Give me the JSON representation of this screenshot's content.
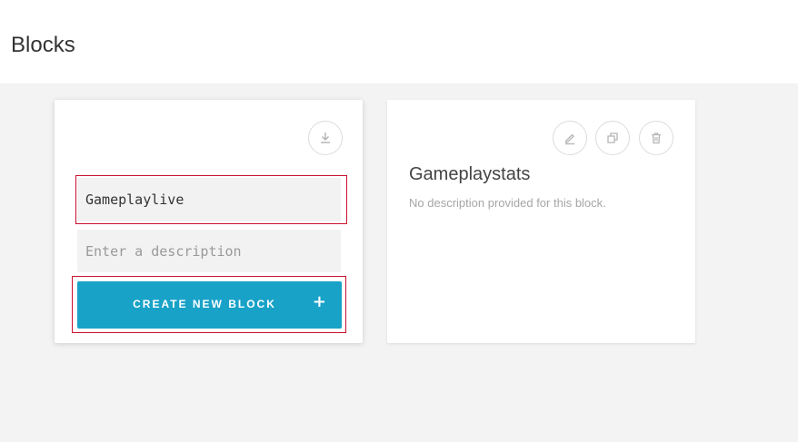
{
  "page": {
    "title": "Blocks"
  },
  "new_block": {
    "name_value": "Gameplaylive",
    "description_placeholder": "Enter a description",
    "create_label": "CREATE NEW BLOCK",
    "create_icon": "+",
    "icons": [
      "download-icon"
    ]
  },
  "blocks": [
    {
      "name": "Gameplaystats",
      "description": "No description provided for this block.",
      "icons": [
        "edit-icon",
        "duplicate-icon",
        "trash-icon"
      ]
    }
  ],
  "colors": {
    "accent": "#19a2c8",
    "highlight_outline": "#c8102e",
    "background": "#f3f3f3"
  }
}
